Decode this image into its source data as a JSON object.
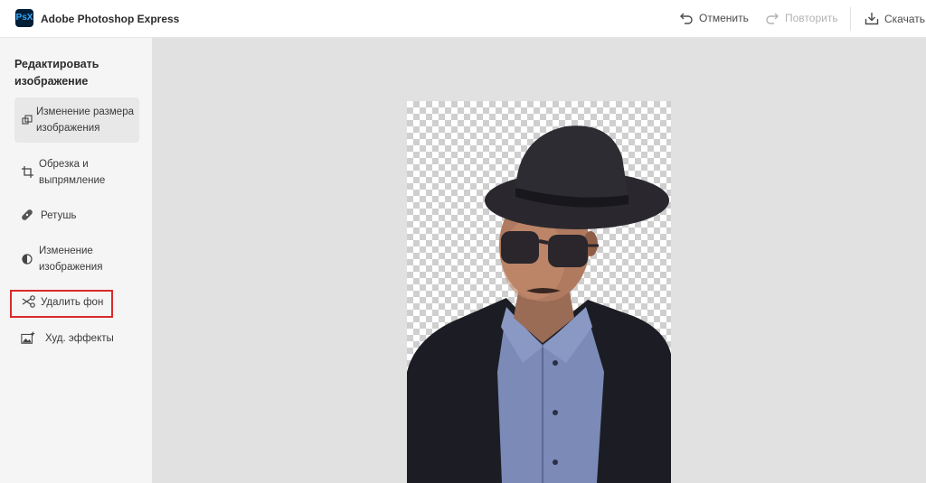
{
  "header": {
    "logo_text": "PsX",
    "app_title": "Adobe Photoshop Express",
    "undo_label": "Отменить",
    "redo_label": "Повторить",
    "download_label": "Скачать"
  },
  "sidebar": {
    "heading": "Редактировать изображение",
    "items": [
      {
        "label": "Изменение размера изображения",
        "icon": "resize-icon",
        "active": true
      },
      {
        "label": "Обрезка и выпрямление",
        "icon": "crop-icon",
        "active": false
      },
      {
        "label": "Ретушь",
        "icon": "bandage-icon",
        "active": false
      },
      {
        "label": "Изменение изображения",
        "icon": "adjust-icon",
        "active": false
      },
      {
        "label": "Удалить фон",
        "icon": "scissors-icon",
        "active": false,
        "highlighted": true
      },
      {
        "label": "Худ. эффекты",
        "icon": "sparkle-image-icon",
        "active": false
      }
    ]
  },
  "colors": {
    "accent_highlight": "#d92b2b",
    "logo_bg": "#001e36",
    "logo_fg": "#31a8ff",
    "canvas_bg": "#e1e1e1",
    "sidebar_bg": "#f5f5f5"
  }
}
